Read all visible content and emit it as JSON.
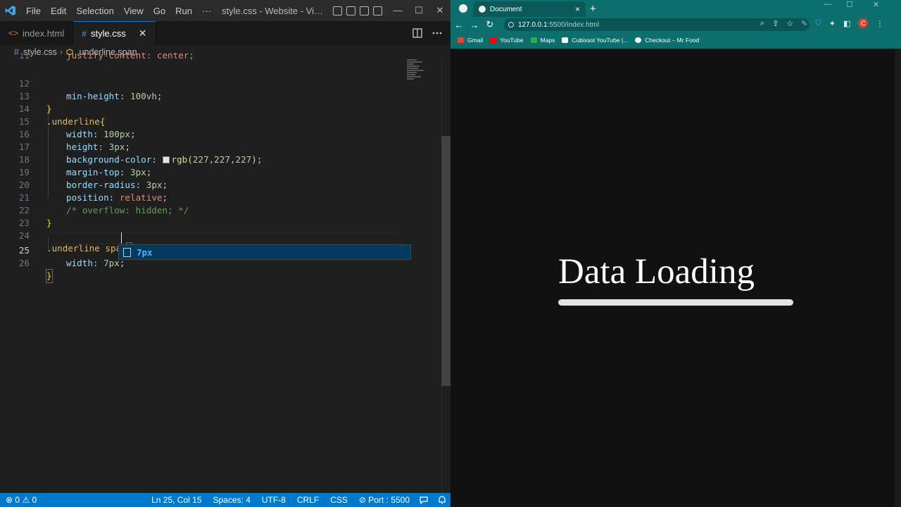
{
  "vscode": {
    "menu": [
      "File",
      "Edit",
      "Selection",
      "View",
      "Go",
      "Run",
      "···"
    ],
    "window_title": "style.css - Website - Visual ...",
    "window_controls": [
      "—",
      "☐",
      "✕"
    ],
    "tabs": [
      {
        "label": "index.html",
        "icon": "<>"
      },
      {
        "label": "style.css",
        "icon": "#"
      }
    ],
    "tab_close": "✕",
    "breadcrumb": {
      "file": "style.css",
      "symbol": ".underline span",
      "sep": "›",
      "file_icon": "#"
    },
    "code": {
      "l11": {
        "num": "11",
        "text": "justify-content: center;"
      },
      "l12": {
        "num": "12",
        "prop": "min-height",
        "colon": ": ",
        "value": "100vh",
        "semi": ";"
      },
      "l13": {
        "num": "13",
        "text": "}"
      },
      "l14": {
        "num": "14",
        "sel": ".underline",
        "brace": "{"
      },
      "l15": {
        "num": "15",
        "prop": "width",
        "colon": ": ",
        "value": "100px",
        "semi": ";"
      },
      "l16": {
        "num": "16",
        "prop": "height",
        "colon": ": ",
        "value": "3px",
        "semi": ";"
      },
      "l17": {
        "num": "17",
        "prop": "background-color",
        "colon": ": ",
        "func": "rgb(",
        "args": "227,227,227",
        "close": ");"
      },
      "l18": {
        "num": "18",
        "prop": "margin-top",
        "colon": ": ",
        "value": "3px",
        "semi": ";"
      },
      "l19": {
        "num": "19",
        "prop": "border-radius",
        "colon": ": ",
        "value": "3px",
        "semi": ";"
      },
      "l20": {
        "num": "20",
        "prop": "position",
        "colon": ": ",
        "value": "relative",
        "semi": ";"
      },
      "l21": {
        "num": "21",
        "text": "/* overflow: hidden; */"
      },
      "l22": {
        "num": "22",
        "text": "}"
      },
      "l23": {
        "num": "23"
      },
      "l24": {
        "num": "24",
        "sel": ".underline span",
        "brace": "{"
      },
      "l25": {
        "num": "25",
        "prop": "width",
        "colon": ": ",
        "value": "7px",
        "semi": ";"
      },
      "l26": {
        "num": "26",
        "text": "}"
      }
    },
    "suggestion": "7px",
    "status": {
      "problems": "⊗ 0 ⚠ 0",
      "position": "Ln 25, Col 15",
      "spaces": "Spaces: 4",
      "encoding": "UTF-8",
      "eol": "CRLF",
      "language": "CSS",
      "port": "⊘ Port : 5500"
    }
  },
  "browser": {
    "tab_title": "Document",
    "url_host": "127.0.0.1",
    "url_path": ":5500/index.html",
    "profile_initial": "C",
    "bookmarks": [
      {
        "label": "Gmail",
        "color": "#ea4335"
      },
      {
        "label": "YouTube",
        "color": "#ff0000"
      },
      {
        "label": "Maps",
        "color": "#34a853"
      },
      {
        "label": "Cubixsol YouTube |...",
        "color": "#ffffff"
      },
      {
        "label": "Checkout – Mr Food",
        "color": "#ffffff"
      }
    ],
    "page_heading": "Data Loading"
  }
}
